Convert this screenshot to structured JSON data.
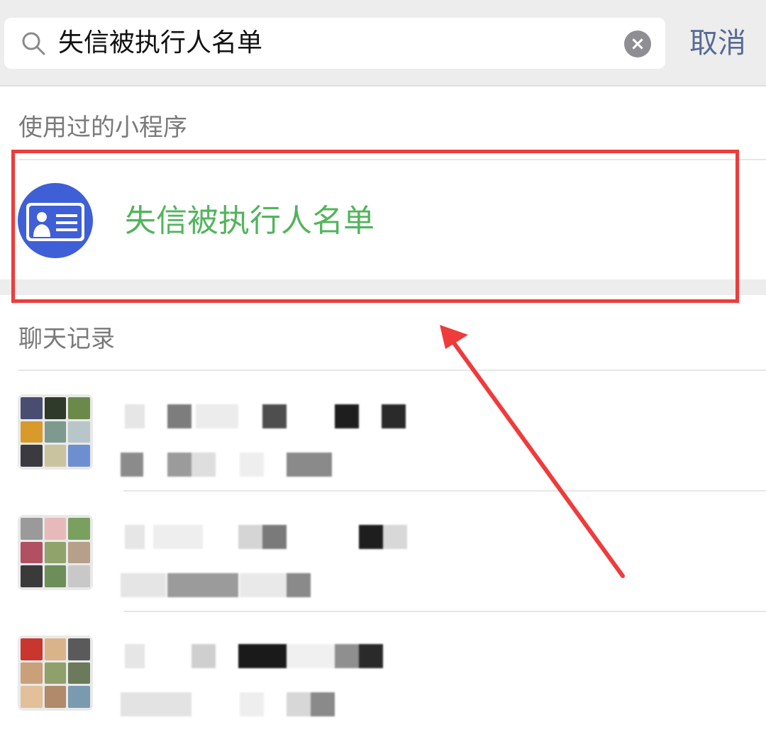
{
  "search": {
    "query": "失信被执行人名单",
    "cancel_label": "取消"
  },
  "sections": {
    "mini_programs_header": "使用过的小程序",
    "chat_history_header": "聊天记录"
  },
  "mini_program": {
    "name": "失信被执行人名单",
    "icon": "id-card-icon"
  },
  "colors": {
    "accent_blue": "#576b95",
    "mini_program_green": "#52b45c",
    "highlight_red": "#ef3b3b",
    "icon_blue": "#3f5fd6"
  },
  "chat_results": [
    {
      "avatar": "group-avatar-icon"
    },
    {
      "avatar": "group-avatar-icon"
    },
    {
      "avatar": "group-avatar-icon"
    }
  ]
}
